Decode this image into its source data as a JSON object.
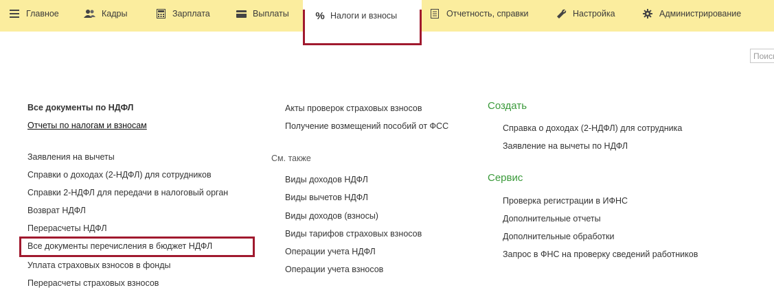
{
  "menu": {
    "items": [
      {
        "icon": "hamburger-icon",
        "label": "Главное"
      },
      {
        "icon": "people-icon",
        "label": "Кадры"
      },
      {
        "icon": "calculator-icon",
        "label": "Зарплата"
      },
      {
        "icon": "wallet-icon",
        "label": "Выплаты"
      },
      {
        "icon": "percent-icon",
        "label": "Налоги и взносы",
        "active": true
      },
      {
        "icon": "document-icon",
        "label": "Отчетность, справки"
      },
      {
        "icon": "wrench-icon",
        "label": "Настройка"
      },
      {
        "icon": "gear-icon",
        "label": "Администрирование"
      }
    ],
    "active_icon_glyph": "%"
  },
  "search": {
    "placeholder": "Поиск (С"
  },
  "col1": {
    "bold_link": "Все документы по НДФЛ",
    "underlined_link": "Отчеты по налогам и взносам",
    "links": [
      "Заявления на вычеты",
      "Справки о доходах (2-НДФЛ) для сотрудников",
      "Справки 2-НДФЛ для передачи в налоговый орган",
      "Возврат НДФЛ",
      "Перерасчеты НДФЛ",
      "Все документы перечисления в бюджет НДФЛ",
      "Уплата страховых взносов в фонды",
      "Перерасчеты страховых взносов"
    ]
  },
  "col2": {
    "links_top": [
      "Акты проверок страховых взносов",
      "Получение возмещений пособий от ФСС"
    ],
    "see_also_label": "См. также",
    "links_see_also": [
      "Виды доходов НДФЛ",
      "Виды вычетов НДФЛ",
      "Виды доходов (взносы)",
      "Виды тарифов страховых взносов",
      "Операции учета НДФЛ",
      "Операции учета взносов"
    ]
  },
  "col3": {
    "create_title": "Создать",
    "create_links": [
      "Справка о доходах (2-НДФЛ) для сотрудника",
      "Заявление на вычеты по НДФЛ"
    ],
    "service_title": "Сервис",
    "service_links": [
      "Проверка регистрации в ИФНС",
      "Дополнительные отчеты",
      "Дополнительные обработки",
      "Запрос в ФНС на проверку сведений работников"
    ]
  },
  "colors": {
    "menubar_bg": "#fbed9e",
    "section_title": "#3a9a3a",
    "highlight_border": "#a0192e"
  }
}
